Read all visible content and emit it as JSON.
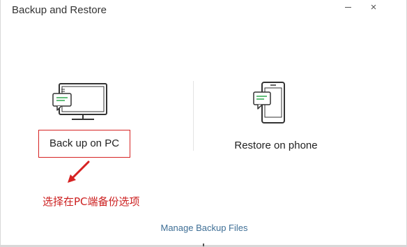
{
  "window": {
    "title": "Backup and Restore",
    "close_glyph": "×"
  },
  "options": {
    "pc": {
      "label": "Back up on PC",
      "icon": "computer-with-chat-icon"
    },
    "phone": {
      "label": "Restore on phone",
      "icon": "phone-with-chat-icon"
    }
  },
  "annotation": {
    "text": "选择在PC端备份选项",
    "color": "#cc1f1f"
  },
  "footer": {
    "manage_link": "Manage Backup Files"
  },
  "colors": {
    "accent_green": "#2fa84f",
    "link_blue": "#3f6f96",
    "highlight_red": "#d62222"
  }
}
